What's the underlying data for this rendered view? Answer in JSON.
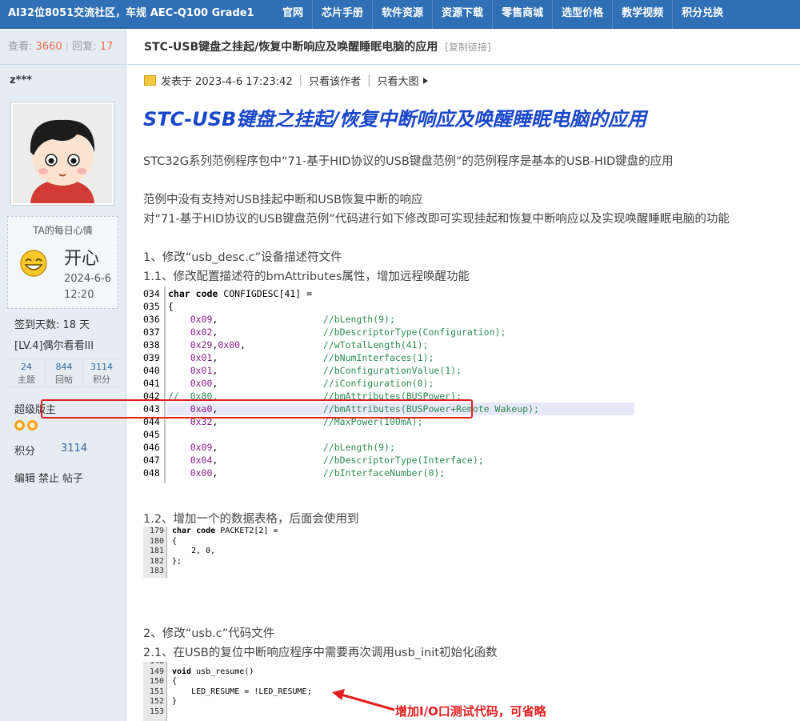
{
  "topnav": {
    "site_title": "AI32位8051交流社区，车规 AEC-Q100 Grade1",
    "items": [
      "官网",
      "芯片手册",
      "软件资源",
      "资源下载",
      "零售商城",
      "选型价格",
      "教学视频",
      "积分兑换"
    ]
  },
  "thread": {
    "views_label": "查看:",
    "views": "3660",
    "replies_label": "回复:",
    "replies": "17",
    "title": "STC-USB键盘之挂起/恢复中断响应及唤醒睡眠电脑的应用",
    "copy_link": "[复制链接]"
  },
  "author": {
    "username": "z***",
    "mood_title": "TA的每日心情",
    "mood": "开心",
    "mood_date": "2024-6-6 12:20",
    "checkin": "签到天数: 18 天",
    "level": "[LV.4]偶尔看看III",
    "counts": [
      {
        "value": "24",
        "label": "主题"
      },
      {
        "value": "844",
        "label": "回帖"
      },
      {
        "value": "3114",
        "label": "积分"
      }
    ],
    "role": "超级版主",
    "points_label": "积分",
    "points_value": "3114",
    "actions": [
      "编辑",
      "禁止",
      "帖子"
    ]
  },
  "post": {
    "posted_prefix": "发表于 2023-4-6 17:23:42",
    "only_author": "只看该作者",
    "large_image": "只看大图",
    "heading": "STC-USB键盘之挂起/恢复中断响应及唤醒睡眠电脑的应用",
    "paragraphs": {
      "p1": "STC32G系列范例程序包中“71-基于HID协议的USB键盘范例”的范例程序是基本的USB-HID键盘的应用",
      "p2": "范例中没有支持对USB挂起中断和USB恢复中断的响应",
      "p3": "对“71-基于HID协议的USB键盘范例”代码进行如下修改即可实现挂起和恢复中断响应以及实现唤醒睡眠电脑的功能",
      "p4": "1、修改“usb_desc.c”设备描述符文件",
      "p5": "1.1、修改配置描述符的bmAttributes属性，增加远程唤醒功能",
      "p6": "1.2、增加一个的数据表格，后面会使用到",
      "p7": "2、修改“usb.c”代码文件",
      "p8": "2.1、在USB的复位中断响应程序中需要再次调用usb_init初始化函数"
    },
    "code1": [
      {
        "ln": "034",
        "code": "char code CONFIGDESC[41] ="
      },
      {
        "ln": "035",
        "code": "{"
      },
      {
        "ln": "036",
        "code": "    0x09,                   //bLength(9);"
      },
      {
        "ln": "037",
        "code": "    0x02,                   //bDescriptorType(Configuration);"
      },
      {
        "ln": "038",
        "code": "    0x29,0x00,              //wTotalLength(41);"
      },
      {
        "ln": "039",
        "code": "    0x01,                   //bNumInterfaces(1);"
      },
      {
        "ln": "040",
        "code": "    0x01,                   //bConfigurationValue(1);"
      },
      {
        "ln": "041",
        "code": "    0x00,                   //iConfiguration(0);"
      },
      {
        "ln": "042",
        "code": "//  0x80,                   //bmAttributes(BUSPower);"
      },
      {
        "ln": "043",
        "code": "    0xa0,                   //bmAttributes(BUSPower+Remote Wakeup);"
      },
      {
        "ln": "044",
        "code": "    0x32,                   //MaxPower(100mA);"
      },
      {
        "ln": "045",
        "code": ""
      },
      {
        "ln": "046",
        "code": "    0x09,                   //bLength(9);"
      },
      {
        "ln": "047",
        "code": "    0x04,                   //bDescriptorType(Interface);"
      },
      {
        "ln": "048",
        "code": "    0x00,                   //bInterfaceNumber(0);"
      }
    ],
    "code2": [
      {
        "ln": "179",
        "code": "char code PACKET2[2] ="
      },
      {
        "ln": "180",
        "code": "{"
      },
      {
        "ln": "181",
        "code": "    2, 0,"
      },
      {
        "ln": "182",
        "code": "};"
      },
      {
        "ln": "183",
        "code": ""
      }
    ],
    "code3": [
      {
        "ln": "148",
        "code": ""
      },
      {
        "ln": "149",
        "code": "void usb_resume()"
      },
      {
        "ln": "150",
        "code": "{"
      },
      {
        "ln": "151",
        "code": "    LED_RESUME = !LED_RESUME;"
      },
      {
        "ln": "152",
        "code": "}"
      },
      {
        "ln": "153",
        "code": ""
      }
    ],
    "arrow_note": "增加I/O口测试代码，可省略"
  }
}
